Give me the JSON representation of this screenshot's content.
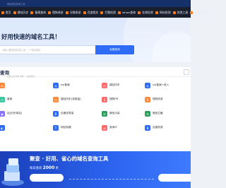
{
  "topbar": {
    "logo_text": "网站域名查询工具·"
  },
  "nav": {
    "items": [
      {
        "label": "首页"
      },
      {
        "label": "建站历史"
      },
      {
        "label": "备案查询"
      },
      {
        "label": "搜狗收录"
      },
      {
        "label": "谷歌收录"
      },
      {
        "label": "百度相关"
      },
      {
        "label": "拦截检测"
      },
      {
        "label": "whois查询"
      },
      {
        "label": "在线检测"
      },
      {
        "label": "网站检测"
      },
      {
        "label": "其他工具"
      },
      {
        "label": "更多域名工具"
      }
    ]
  },
  "hero": {
    "title": "好用快速的域名工具！",
    "search_placeholder": "请输入要查询的域名 如: 一个域名网站",
    "search_button": "免费查询"
  },
  "panel": {
    "title": "查询",
    "subtitle": "免费 实用 简单 高效 · 一站式查询"
  },
  "tools": [
    [
      {
        "label": "",
        "icon": "◎",
        "color": "#ff8a3d"
      },
      {
        "label": "icp备案",
        "icon": "◎",
        "color": "#2e6cf5"
      },
      {
        "label": "建站历史",
        "icon": "◷",
        "color": "#ff6b6b"
      },
      {
        "label": "icp备案+收入",
        "icon": "◎",
        "color": "#2e6cf5"
      }
    ],
    [
      {
        "label": "备案",
        "icon": "◇",
        "color": "#3ec7a0"
      },
      {
        "label": "建站历史(多数量)",
        "icon": "◷",
        "color": "#ff8a3d"
      },
      {
        "label": "搜狗PR",
        "icon": "S",
        "color": "#ff6b6b"
      },
      {
        "label": "搜狗收录",
        "icon": "S",
        "color": "#ff8a3d"
      }
    ],
    [
      {
        "label": "站(历史域名)",
        "icon": "◉",
        "color": "#8a73ff"
      },
      {
        "label": "百度收录量",
        "icon": "B",
        "color": "#2e6cf5"
      },
      {
        "label": "微信污染",
        "icon": "✉",
        "color": "#2e9e5b"
      },
      {
        "label": "微信拦截",
        "icon": "✉",
        "color": "#2e9e5b"
      }
    ],
    [
      {
        "label": "",
        "icon": "◐",
        "color": "#2e6cf5"
      },
      {
        "label": "网站标题",
        "icon": "T",
        "color": "#2e6cf5"
      },
      {
        "label": "查询IP",
        "icon": "◎",
        "color": "#ff6b6b"
      },
      {
        "label": "百度收录",
        "icon": "B",
        "color": "#2e6cf5"
      }
    ]
  ],
  "banner": {
    "title": "聚查 · 好用、省心的域名查询工具",
    "line_prefix": "每日查询",
    "line_value": "2000",
    "line_suffix": "条"
  }
}
